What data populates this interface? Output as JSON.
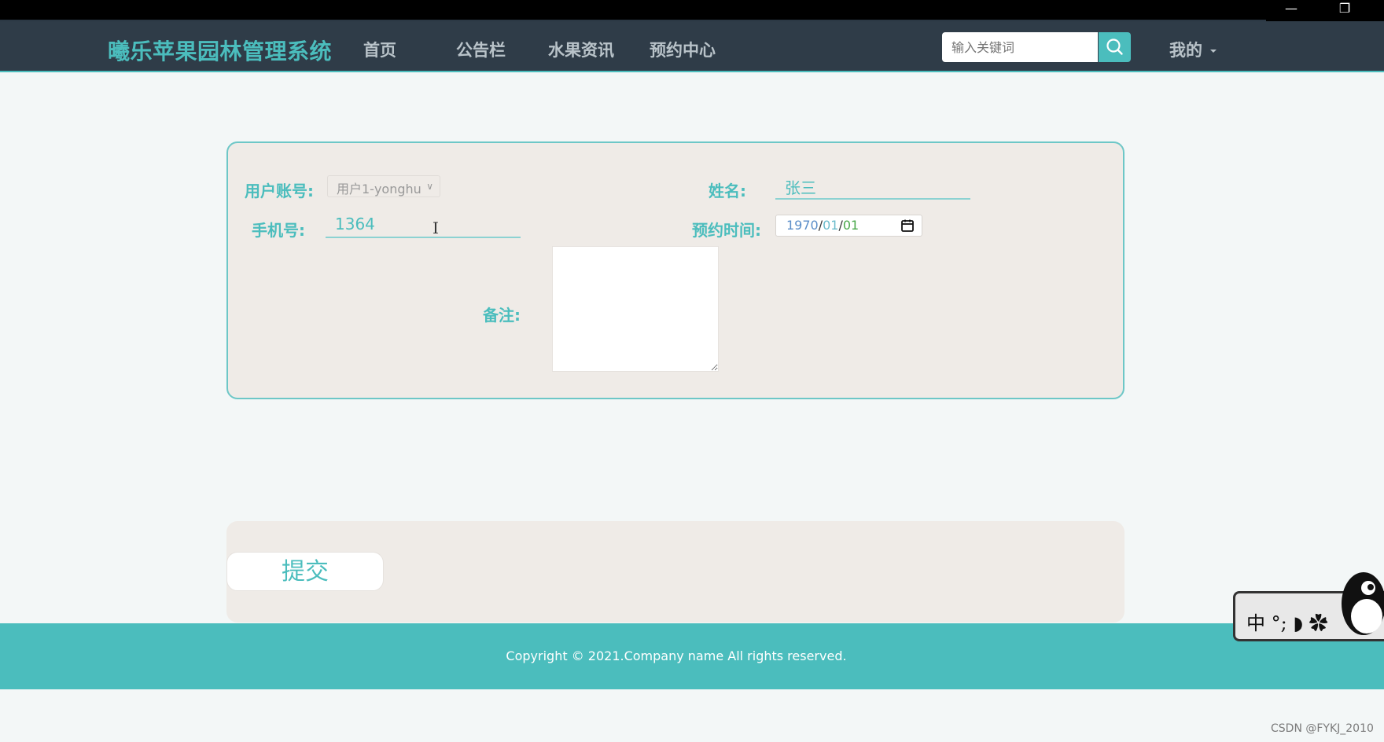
{
  "window": {
    "minimize_glyph": "—",
    "restore_glyph": "❐"
  },
  "navbar": {
    "brand": "曦乐苹果园林管理系统",
    "items": [
      {
        "label": "首页"
      },
      {
        "label": "公告栏"
      },
      {
        "label": "水果资讯"
      },
      {
        "label": "预约中心"
      }
    ],
    "search": {
      "placeholder": "输入关键词",
      "icon": "search-icon"
    },
    "user_menu": {
      "label": "我的",
      "icon": "caret-down-icon"
    }
  },
  "form": {
    "account": {
      "label": "用户账号:",
      "selected": "用户1-yonghu"
    },
    "name": {
      "label": "姓名:",
      "value": "张三"
    },
    "phone": {
      "label": "手机号:",
      "value": "1364"
    },
    "appointment_time": {
      "label": "预约时间:",
      "year": "1970",
      "month": "01",
      "day": "01",
      "separator": "/",
      "icon": "calendar-icon"
    },
    "note": {
      "label": "备注:",
      "value": ""
    }
  },
  "actions": {
    "submit_label": "提交"
  },
  "footer": {
    "copyright": "Copyright © 2021.Company name All rights reserved."
  },
  "ime": {
    "text": "中 °; ◗ ✿"
  },
  "watermark": "CSDN @FYKJ_2010",
  "colors": {
    "accent": "#4bbdbd",
    "nav_bg": "#2f3c48",
    "card_bg": "#efebe7",
    "page_bg": "#f3f7f7"
  }
}
